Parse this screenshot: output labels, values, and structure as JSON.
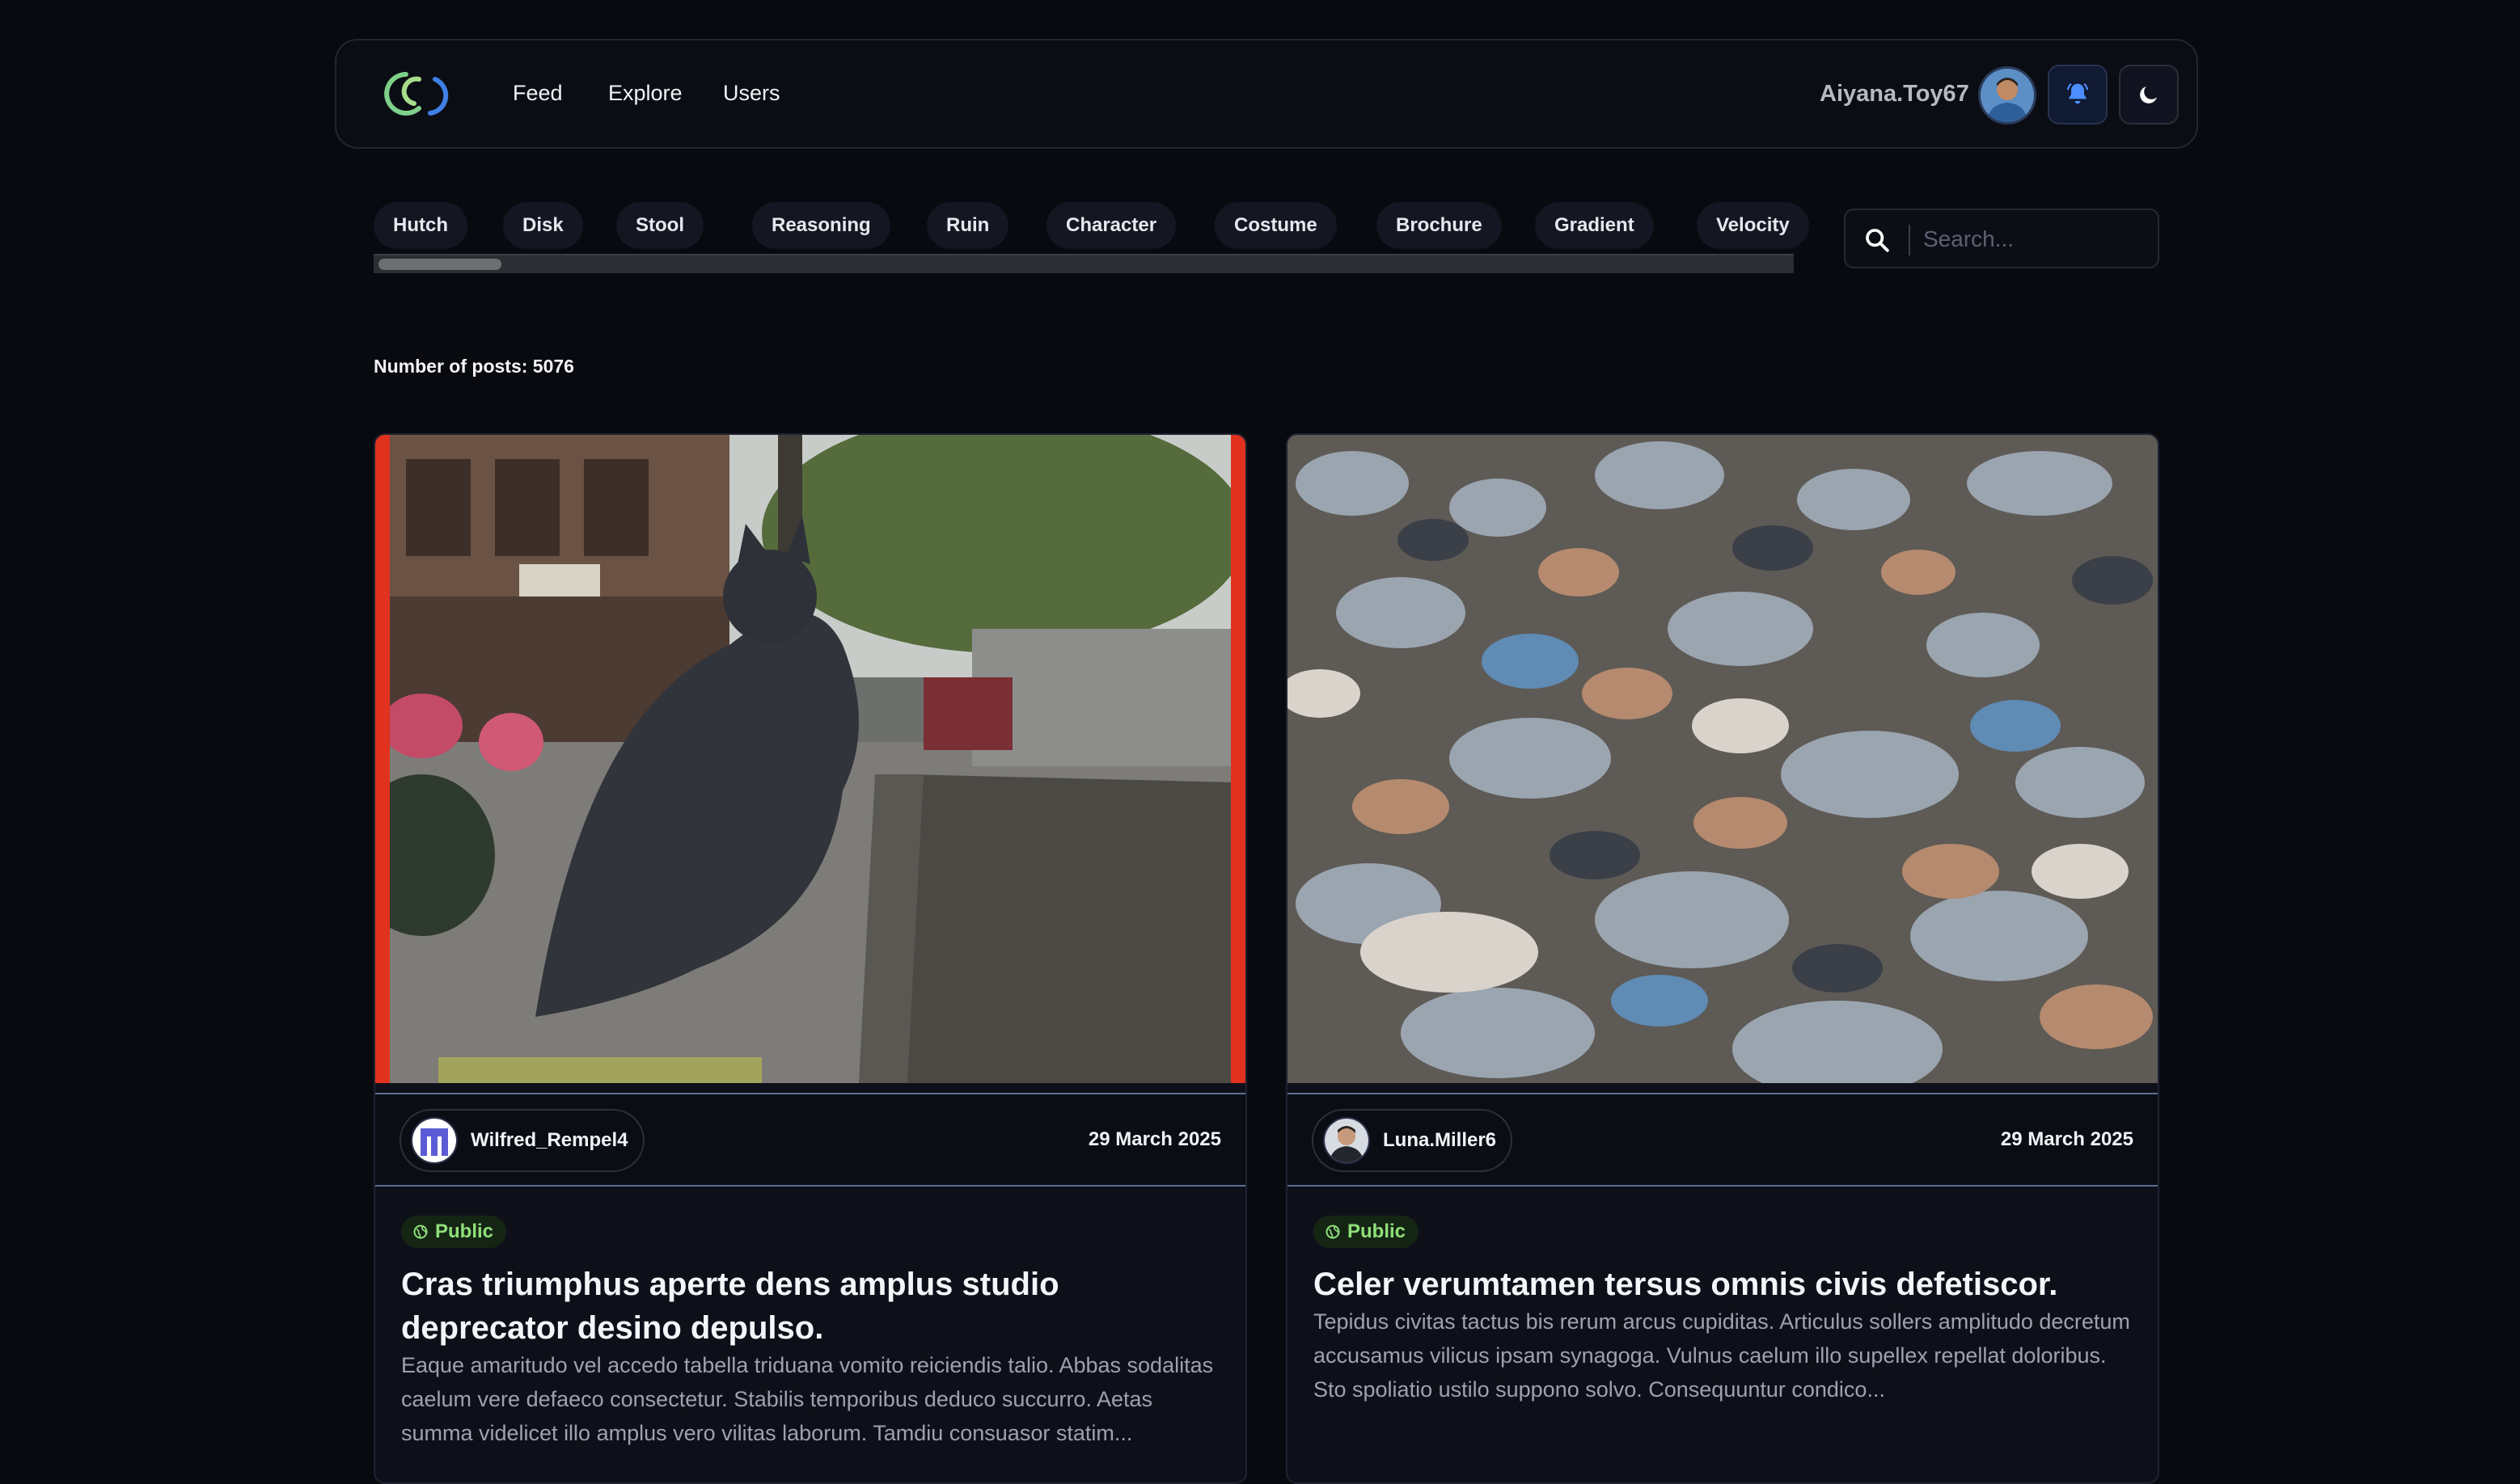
{
  "nav": {
    "links": [
      "Feed",
      "Explore",
      "Users"
    ],
    "username": "Aiyana.Toy67"
  },
  "tags": [
    "Hutch",
    "Disk",
    "Stool",
    "Reasoning",
    "Ruin",
    "Character",
    "Costume",
    "Brochure",
    "Gradient",
    "Velocity"
  ],
  "search": {
    "placeholder": "Search..."
  },
  "post_count_text": "Number of posts: 5076",
  "posts": [
    {
      "author": "Wilfred_Rempel4",
      "date": "29 March 2025",
      "visibility": "Public",
      "title": "Cras triumphus aperte dens amplus studio deprecator desino depulso.",
      "body": "Eaque amaritudo vel accedo tabella triduana vomito reiciendis talio. Abbas sodalitas caelum vere defaeco consectetur. Stabilis temporibus deduco succurro. Aetas summa videlicet illo amplus vero vilitas laborum. Tamdiu consuasor statim..."
    },
    {
      "author": "Luna.Miller6",
      "date": "29 March 2025",
      "visibility": "Public",
      "title": "Celer verumtamen tersus omnis civis defetiscor.",
      "body": "Tepidus civitas tactus bis rerum arcus cupiditas. Articulus sollers amplitudo decretum accusamus vilicus ipsam synagoga. Vulnus caelum illo supellex repellat doloribus. Sto spoliatio ustilo suppono solvo. Consequuntur condico..."
    }
  ],
  "colors": {
    "background": "#080a10",
    "accent_red": "#e0321e",
    "badge_green": "#8fe07a",
    "bell_blue": "#4d8dff"
  }
}
